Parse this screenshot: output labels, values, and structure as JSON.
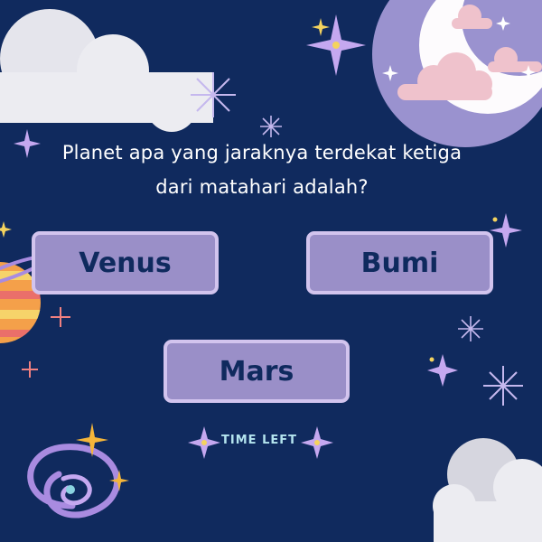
{
  "quiz": {
    "question_line1": "Planet apa yang jaraknya terdekat ketiga",
    "question_line2": "dari matahari adalah?",
    "options": [
      {
        "label": "Venus"
      },
      {
        "label": "Bumi"
      },
      {
        "label": "Mars"
      }
    ],
    "timer_label": "TIME LEFT"
  },
  "colors": {
    "background": "#102a5e",
    "option_fill": "#9a8fc8",
    "option_border": "#d2c4ee",
    "option_text": "#0f2a5e",
    "timer_text": "#b4e4ee",
    "moon_halo": "#9a92cf",
    "cloud": "#ececf1",
    "pink_cloud": "#efc2cc"
  },
  "icons": [
    "cloud-icon",
    "moon-icon",
    "sparkle-star-icon",
    "galaxy-icon",
    "planet-icon"
  ]
}
